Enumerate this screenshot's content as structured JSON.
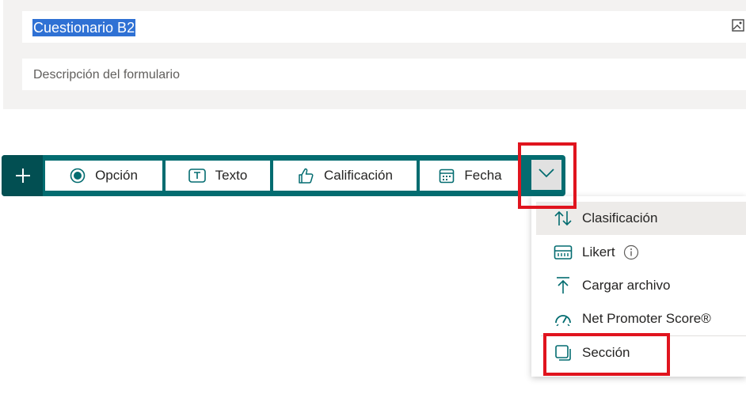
{
  "form": {
    "title": "Cuestionario B2",
    "description_placeholder": "Descripción del formulario"
  },
  "toolbar": {
    "add_icon": "plus-icon",
    "buttons": [
      {
        "label": "Opción",
        "icon": "radio-icon"
      },
      {
        "label": "Texto",
        "icon": "text-icon"
      },
      {
        "label": "Calificación",
        "icon": "thumbs-up-icon"
      },
      {
        "label": "Fecha",
        "icon": "calendar-icon"
      }
    ],
    "more_icon": "chevron-down-icon"
  },
  "dropdown": {
    "items": [
      {
        "label": "Clasificación",
        "icon": "sort-arrows-icon",
        "highlighted": true
      },
      {
        "label": "Likert",
        "icon": "likert-grid-icon",
        "info": true
      },
      {
        "label": "Cargar archivo",
        "icon": "upload-icon"
      },
      {
        "label": "Net Promoter Score®",
        "icon": "gauge-icon"
      },
      {
        "label": "Sección",
        "icon": "section-icon"
      }
    ]
  },
  "colors": {
    "toolbar": "#036c70",
    "toolbar_dark": "#024f52",
    "selection": "#2f71d4",
    "highlight_box": "#e0141e"
  }
}
